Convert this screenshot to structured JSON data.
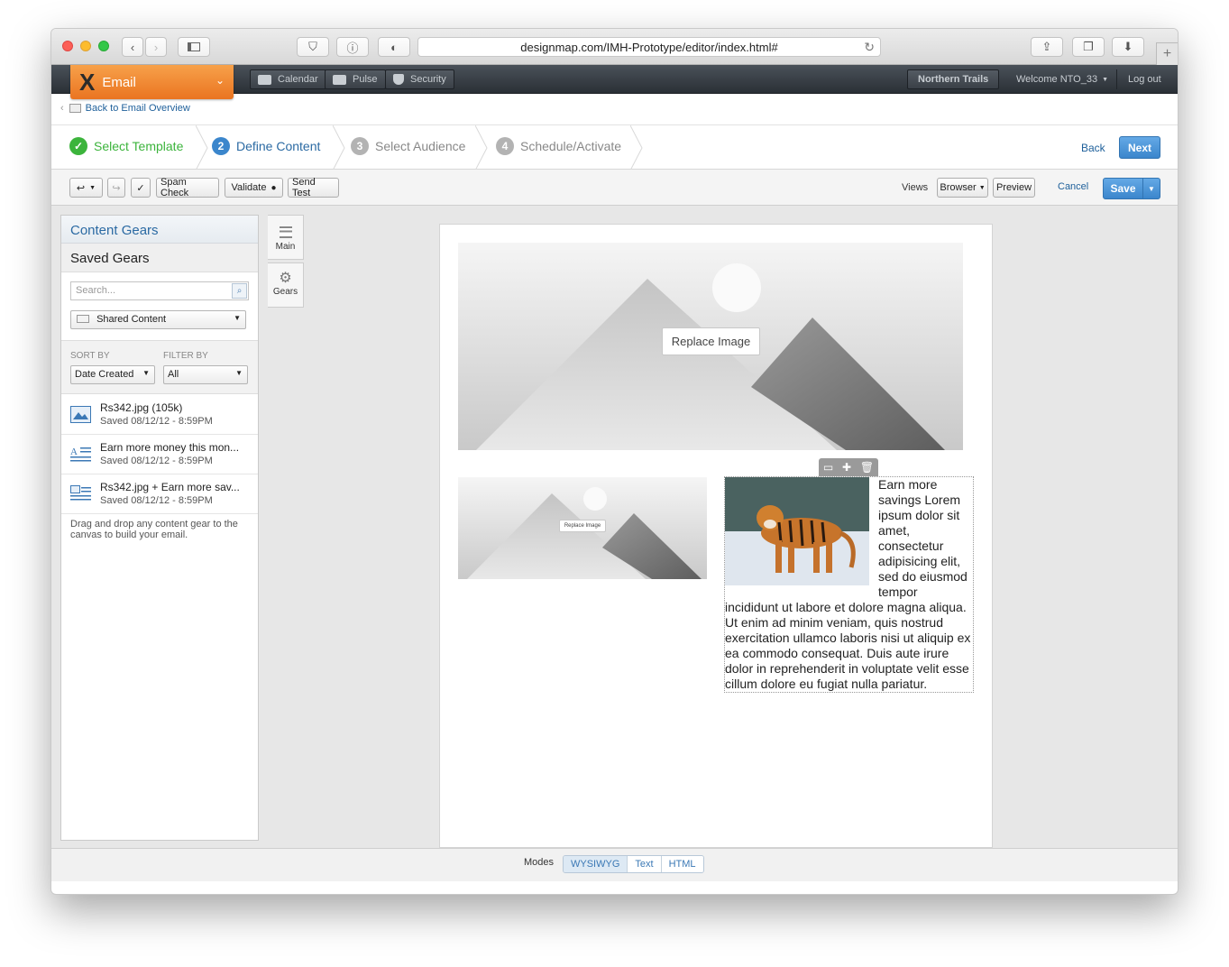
{
  "browser": {
    "url": "designmap.com/IMH-Prototype/editor/index.html#"
  },
  "appbar": {
    "app_name": "Email",
    "tabs": [
      {
        "label": "Calendar",
        "icon": "calendar-icon"
      },
      {
        "label": "Pulse",
        "icon": "pulse-icon"
      },
      {
        "label": "Security",
        "icon": "shield-icon"
      }
    ],
    "org": "Northern Trails",
    "welcome": "Welcome NTO_33",
    "logout": "Log out"
  },
  "breadcrumb": {
    "back_label": "Back to Email Overview"
  },
  "wizard": {
    "steps": [
      {
        "num": "✓",
        "label": "Select Template",
        "state": "done"
      },
      {
        "num": "2",
        "label": "Define Content",
        "state": "current"
      },
      {
        "num": "3",
        "label": "Select Audience",
        "state": "pending"
      },
      {
        "num": "4",
        "label": "Schedule/Activate",
        "state": "pending"
      }
    ],
    "back": "Back",
    "next": "Next"
  },
  "toolbar": {
    "spam_check": "Spam Check",
    "validate": "Validate",
    "send_test": "Send Test",
    "views_label": "Views",
    "view_select": "Browser",
    "preview": "Preview",
    "cancel": "Cancel",
    "save": "Save"
  },
  "left_panel": {
    "title": "Content Gears",
    "section": "Saved Gears",
    "search_placeholder": "Search...",
    "folder_select": "Shared Content",
    "sort_label": "SORT BY",
    "filter_label": "FILTER BY",
    "sort_value": "Date Created",
    "filter_value": "All",
    "items": [
      {
        "title": "Rs342.jpg (105k)",
        "saved": "Saved 08/12/12 - 8:59PM",
        "icon": "image-icon"
      },
      {
        "title": "Earn more money this mon...",
        "saved": "Saved 08/12/12 - 8:59PM",
        "icon": "text-icon"
      },
      {
        "title": "Rs342.jpg + Earn more sav...",
        "saved": "Saved 08/12/12 - 8:59PM",
        "icon": "image-text-icon"
      }
    ],
    "hint": "Drag and drop any content gear to the canvas to build your email."
  },
  "side_tabs": {
    "main": "Main",
    "gears": "Gears"
  },
  "canvas": {
    "hero_replace": "Replace Image",
    "small_replace": "Replace Image",
    "body_text": "Earn more savings Lorem ipsum dolor sit amet, consectetur adipisicing elit, sed do eiusmod tempor incididunt ut labore et dolore magna aliqua. Ut enim ad minim veniam, quis nostrud exercitation ullamco laboris nisi ut aliquip ex ea commodo consequat. Duis aute irure dolor in reprehenderit in voluptate velit esse cillum dolore eu fugiat nulla pariatur."
  },
  "footer": {
    "modes_label": "Modes",
    "modes": [
      "WYSIWYG",
      "Text",
      "HTML"
    ],
    "active_mode": "WYSIWYG"
  },
  "colors": {
    "accent_blue": "#3b86cc",
    "orange": "#ea7421",
    "success_green": "#3cb43c"
  }
}
